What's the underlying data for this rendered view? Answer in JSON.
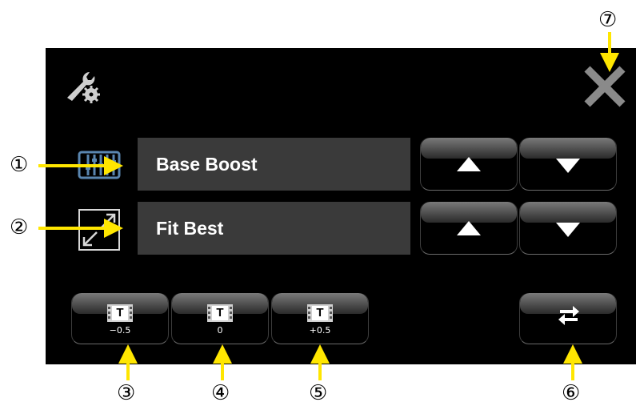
{
  "callouts": [
    "①",
    "②",
    "③",
    "④",
    "⑤",
    "⑥",
    "⑦"
  ],
  "rows": [
    {
      "label": "Base Boost",
      "icon": "equalizer-icon"
    },
    {
      "label": "Fit Best",
      "icon": "expand-arrows-icon"
    }
  ],
  "subtitle_buttons": [
    {
      "letter": "T",
      "value": "−0.5"
    },
    {
      "letter": "T",
      "value": "0"
    },
    {
      "letter": "T",
      "value": "+0.5"
    }
  ],
  "colors": {
    "panel": "#000000",
    "field": "#3a3a3a",
    "arrow": "#ffe600",
    "close": "#8a8a8a",
    "icon_blue": "#5a86b0"
  }
}
